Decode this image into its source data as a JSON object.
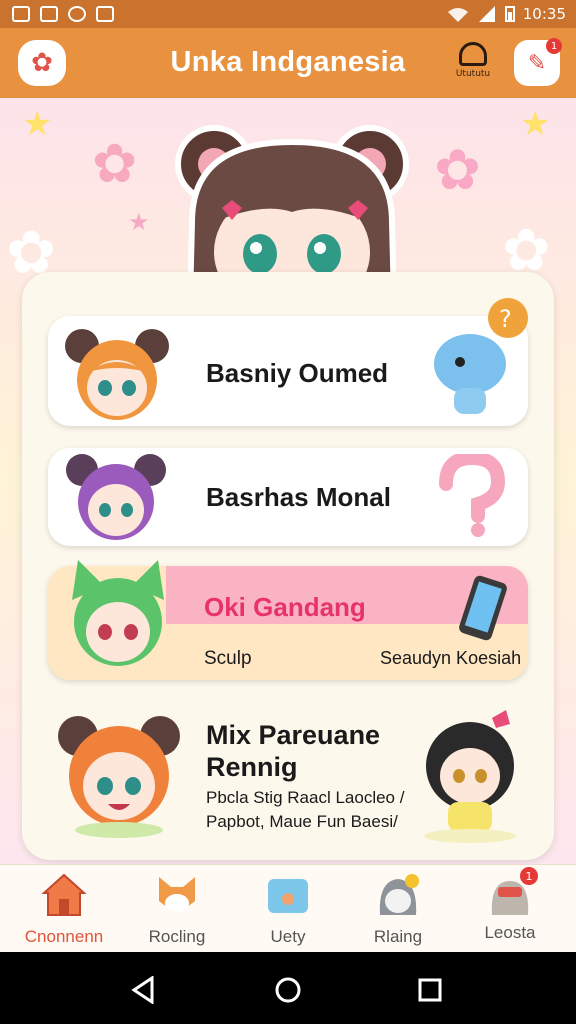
{
  "status": {
    "time": "10:35"
  },
  "app": {
    "title": "Unka Indganesia",
    "bell_label": "Utututu",
    "notif_count": "1"
  },
  "cards": [
    {
      "title": "Basniy Oumed"
    },
    {
      "title": "Basrhas Monal"
    },
    {
      "title": "Oki Gandang",
      "left": "Sculp",
      "right": "Seaudyn Koesiah"
    },
    {
      "title_line1": "Mix Pareuane",
      "title_line2": "Rennig",
      "desc_line1": "Pbcla Stig Raacl Laocleo /",
      "desc_line2": "Papbot, Maue Fun Baesi/"
    }
  ],
  "nav": [
    {
      "label": "Cnonnenn",
      "active": true
    },
    {
      "label": "Rocling"
    },
    {
      "label": "Uety"
    },
    {
      "label": "Rlaing"
    },
    {
      "label": "Leosta",
      "badge": "1"
    }
  ],
  "colors": {
    "appbar": "#e8913f",
    "accent_pink": "#e8336a",
    "active_nav": "#e0543b"
  }
}
